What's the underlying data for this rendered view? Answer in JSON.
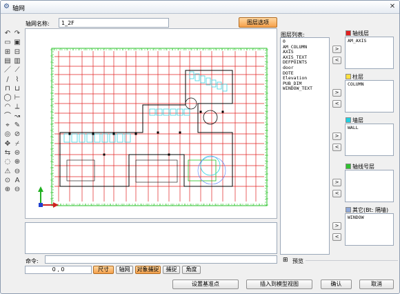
{
  "window": {
    "title": "轴网",
    "icon": "app-icon",
    "close_glyph": "✕"
  },
  "form": {
    "name_label": "轴网名称:",
    "name_value": "1_2F",
    "layer_button": "图层选项"
  },
  "layer_list": {
    "label": "图层列表:",
    "items": [
      "0",
      "AM_COLUMN",
      "AXIS",
      "AXIS_TEXT",
      "DEFPOINTS",
      "door",
      "DOTE",
      "Elevation",
      "PUB_DIM",
      "WINDOW_TEXT"
    ]
  },
  "groups": [
    {
      "label": "轴线层",
      "color": "#e02020",
      "items": [
        "AM_AXIS"
      ]
    },
    {
      "label": "柱层",
      "color": "#ffe040",
      "items": [
        "COLUMN"
      ]
    },
    {
      "label": "墙层",
      "color": "#20d0e0",
      "items": [
        "WALL"
      ]
    },
    {
      "label": "轴线号层",
      "color": "#30c030",
      "items": []
    },
    {
      "label": "其它(Bt: 隔墙)",
      "color": "#8fa8d8",
      "items": [
        "WINDOW"
      ]
    }
  ],
  "arrows": {
    "right": ">",
    "left": "<"
  },
  "command": {
    "label": "命令:",
    "value": ""
  },
  "status": {
    "coords": "0 , 0",
    "buttons": [
      "尺寸",
      "轴网",
      "对象捕捉",
      "捕捉",
      "角度"
    ]
  },
  "preview": {
    "toggle": "⊞",
    "label": "预览"
  },
  "bottom": {
    "set_base": "设置基准点",
    "insert": "插入到模型视图",
    "ok": "确认",
    "cancel": "取消"
  },
  "tools": [
    "↶",
    "↷",
    "▭",
    "▣",
    "⊞",
    "⊟",
    "▤",
    "▥",
    "／",
    "⟋",
    "∕",
    "⌇",
    "⊓",
    "⊔",
    "◯",
    "⊢",
    "◠",
    "⟂",
    "⌒",
    "↝",
    "⌖",
    "✎",
    "◎",
    "⊘",
    "✥",
    "⌿",
    "⇆",
    "⊜",
    "◌",
    "⊕",
    "⚠",
    "⊖",
    "⊙",
    "A",
    "⊕",
    "⊖"
  ],
  "colors": {
    "accent_orange": "#f5a04a",
    "grid_red": "#e02020",
    "wall_green": "#20c020",
    "wall_cyan": "#20d0e0"
  }
}
